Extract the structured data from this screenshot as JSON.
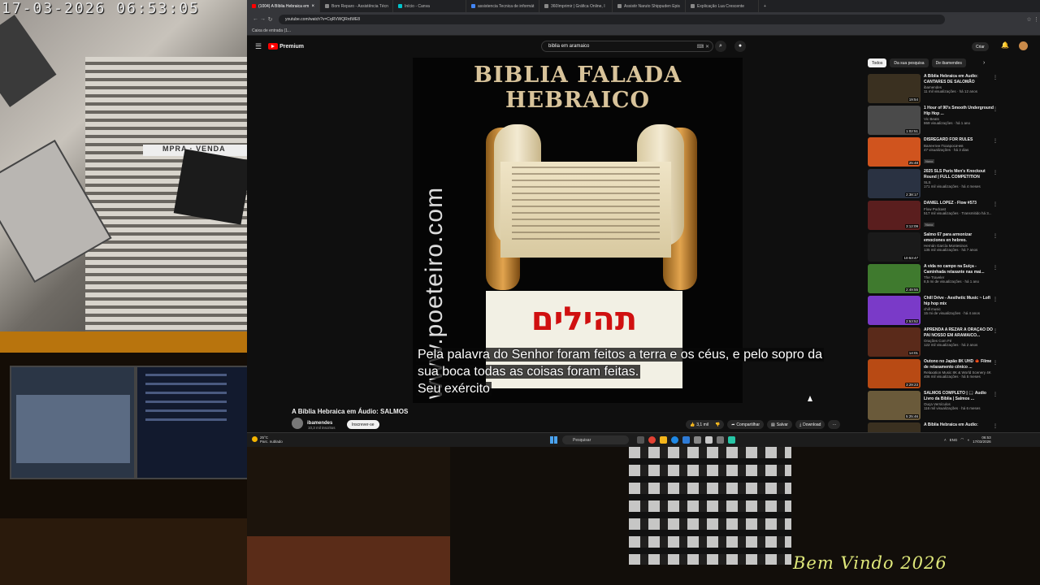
{
  "overlay": {
    "timestamp": "17-03-2026 06:53:05",
    "welcome": "Bem Vindo 2026",
    "shop_sign": "MPRA · VENDA"
  },
  "browser": {
    "tabs": [
      {
        "label": "(1004) A Bíblia Hebraica em",
        "active": true
      },
      {
        "label": "Bom Reparo - Assistência Técn",
        "active": false
      },
      {
        "label": "Início - Canva",
        "active": false
      },
      {
        "label": "assistencia Tecnica de informát",
        "active": false
      },
      {
        "label": "360Imprimir | Gráfica Online, I",
        "active": false
      },
      {
        "label": "Assistir Naruto Shippuden Epis",
        "active": false
      },
      {
        "label": "Explicação Lua Crescente",
        "active": false
      }
    ],
    "new_tab": "+",
    "url": "youtube.com/watch?v=CqRVWQRrdWE8",
    "bookmark": "Caixa de entrada (1..."
  },
  "youtube": {
    "logo": "Premium",
    "search_value": "biblia em aramaico",
    "create_label": "Criar",
    "video": {
      "thumb_title": "BIBLIA FALADA HEBRAICO",
      "vertical_text": "www.poeteiro.com",
      "hebrew_word": "תהילים",
      "caption_lines": [
        "Pela palavra do Senhor foram feitos a terra e os céus, e pelo sopro da",
        "sua boca todas as coisas foram feitas.",
        "Seu exército"
      ],
      "title": "A Bíblia Hebraica em Áudio: SALMOS",
      "channel": "ibamendes",
      "subscribers": "10,3 mil inscritos",
      "subscribe_label": "Inscrever-se",
      "likes": "3,1 mil",
      "share_label": "Compartilhar",
      "save_label": "Salvar",
      "download_label": "Download",
      "more_label": "···"
    },
    "chips": [
      {
        "label": "Todos",
        "selected": true
      },
      {
        "label": "Da sua pesquisa",
        "selected": false
      },
      {
        "label": "De ibamendes",
        "selected": false
      }
    ],
    "recommendations": [
      {
        "title": "A Bíblia Hebraica em Áudio: CANTARES DE SALOMÃO",
        "channel": "ibamendes",
        "views": "11 mil visualizações · há 12 anos",
        "duration": "19:54",
        "color": "#3a3020",
        "badge": ""
      },
      {
        "title": "1 Hour of 90's Smooth Underground Hip Hop ...",
        "channel": "Vic Beats",
        "views": "869 visualizações · há 1 ano",
        "duration": "1:02:51",
        "color": "#4a4a4a",
        "badge": ""
      },
      {
        "title": "DISREGARD FOR RULES",
        "channel": "Валентин Позаросачев",
        "views": "47 visualizações · há 3 dias",
        "duration": "25:48",
        "color": "#d0541e",
        "badge": "Novo"
      },
      {
        "title": "2025 SLS Paris Men's Knockout Round | FULL COMPETITION",
        "channel": "SLS",
        "views": "171 mil visualizações · há 4 meses",
        "duration": "2:38:17",
        "color": "#2a3242",
        "badge": ""
      },
      {
        "title": "DANIEL LOPEZ - Flow #573",
        "channel": "Flow Podcast",
        "views": "517 mil visualizações · Transmitido há 3...",
        "duration": "3:12:09",
        "color": "#5a1e1e",
        "badge": "Novo"
      },
      {
        "title": "Salmo 67 para armonizar emociones en hebreo.",
        "channel": "Hernán García Montesinos",
        "views": "135 mil visualizações · há 7 anos",
        "duration": "10:53:47",
        "color": "#1a1a1a",
        "badge": ""
      },
      {
        "title": "A vida no campo na Suíça - Caminhada relaxante nas mai...",
        "channel": "The Traveler",
        "views": "8,5 mi de visualizações · há 1 ano",
        "duration": "2:49:55",
        "color": "#3f7a2e",
        "badge": ""
      },
      {
        "title": "Chill Drive - Aesthetic Music ~ Lofi hip hop mix",
        "channel": "chill music",
        "views": "15 mi de visualizações · há 4 anos",
        "duration": "2:53:52",
        "color": "#7a3ac8",
        "badge": ""
      },
      {
        "title": "APRENDA A REZAR A ORAÇÃO DO PAI NOSSO EM ARAMAICO...",
        "channel": "Orações Com Fé",
        "views": "122 mil visualizações · há 2 anos",
        "duration": "14:01",
        "color": "#5a2a1a",
        "badge": ""
      },
      {
        "title": "Outono no Japão 8K UHD 🍁 Filme de relaxamento cênico ...",
        "channel": "Relaxation Music 8K & World Scenery 4K",
        "views": "406 mil visualizações · há 5 meses",
        "duration": "3:29:23",
        "color": "#b84a14",
        "badge": ""
      },
      {
        "title": "SALMOS COMPLETO | 🎧 Áudio Livro da Bíblia | Salmos ...",
        "channel": "Ouça Versículos",
        "views": "116 mil visualizações · há 6 meses",
        "duration": "5:25:46",
        "color": "#6a5a3a",
        "badge": ""
      },
      {
        "title": "A Bíblia Hebraica em Áudio:",
        "channel": "",
        "views": "",
        "duration": "",
        "color": "#3a3020",
        "badge": ""
      }
    ]
  },
  "taskbar": {
    "temp": "25°C",
    "weather": "Parc. nublado",
    "search_label": "Pesquisar",
    "lang": "ENG",
    "time": "06:53",
    "date": "17/03/2026"
  }
}
